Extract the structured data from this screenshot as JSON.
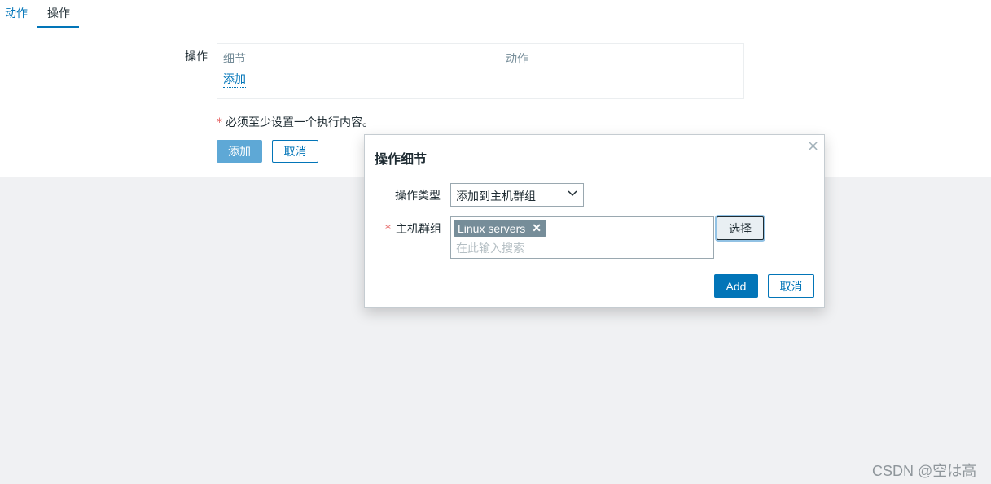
{
  "tabs": [
    {
      "label": "动作"
    },
    {
      "label": "操作"
    }
  ],
  "form": {
    "operations_label": "操作",
    "table": {
      "columns": [
        "细节",
        "动作"
      ],
      "add_link": "添加"
    },
    "required_star": "*",
    "required_note": "必须至少设置一个执行内容。",
    "add_button": "添加",
    "cancel_button": "取消"
  },
  "dialog": {
    "title": "操作细节",
    "close_icon": "×",
    "operation_type": {
      "label": "操作类型",
      "value": "添加到主机群组"
    },
    "host_group": {
      "required_star": "*",
      "label": "主机群组",
      "tags": [
        {
          "label": "Linux servers",
          "remove_icon": "✕"
        }
      ],
      "placeholder": "在此输入搜索",
      "select_button": "选择"
    },
    "add_button": "Add",
    "cancel_button": "取消"
  },
  "watermark": "CSDN @空は高",
  "colors": {
    "accent": "#0275b8",
    "required": "#e45959",
    "tag_bg": "#768d99",
    "page_bg": "#f0f1f3"
  }
}
